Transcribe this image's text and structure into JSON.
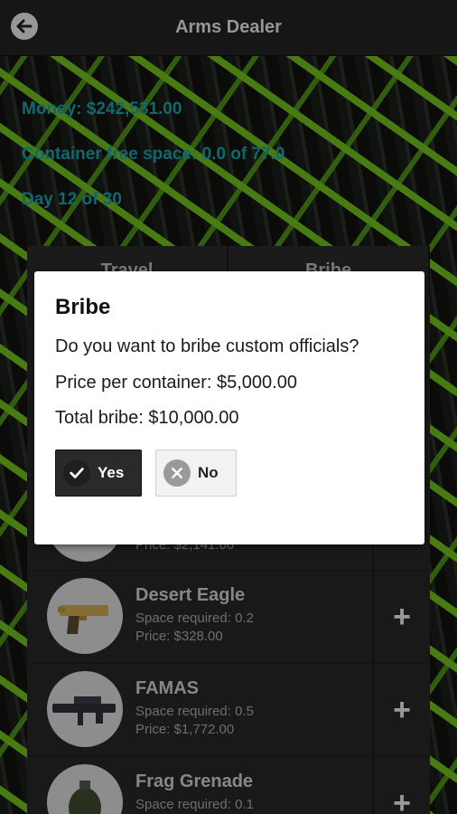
{
  "header": {
    "title": "Arms Dealer",
    "back_icon": "back-arrow-icon"
  },
  "stats": {
    "money": "Money: $242,531.00",
    "container": "Container free space: 0.0 of 77.0",
    "day": "Day 12 of 30"
  },
  "tabs": [
    {
      "label": "Travel"
    },
    {
      "label": "Bribe"
    }
  ],
  "items": [
    {
      "name": "",
      "space": "",
      "price": "Price: $2,141.00"
    },
    {
      "name": "Desert Eagle",
      "space": "Space required: 0.2",
      "price": "Price: $328.00"
    },
    {
      "name": "FAMAS",
      "space": "Space required: 0.5",
      "price": "Price: $1,772.00"
    },
    {
      "name": "Frag Grenade",
      "space": "Space required: 0.1",
      "price": ""
    }
  ],
  "dialog": {
    "title": "Bribe",
    "question": "Do you want to bribe custom officials?",
    "price_per_container": "Price per container: $5,000.00",
    "total_bribe": "Total bribe: $10,000.00",
    "yes_label": "Yes",
    "no_label": "No"
  },
  "colors": {
    "stat_text": "#1aa0a8",
    "accent_green": "#6fbf1e"
  }
}
